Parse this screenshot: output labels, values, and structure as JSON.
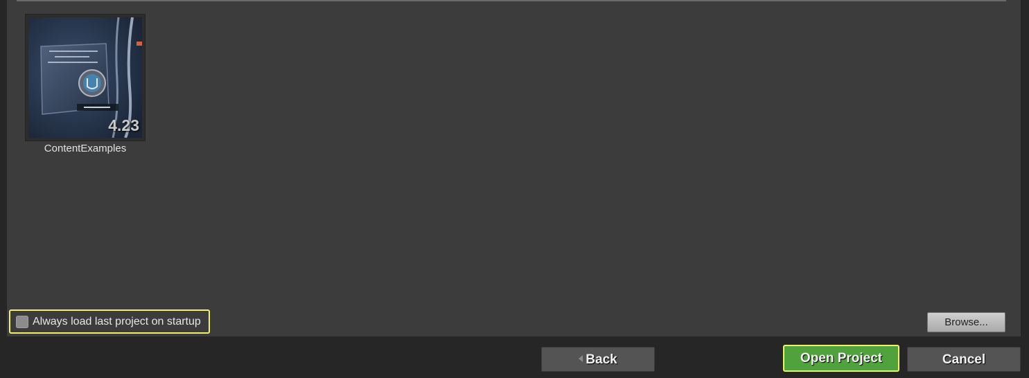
{
  "projects": [
    {
      "name": "ContentExamples",
      "version": "4.23",
      "thumbnail_icon": "unreal-engine-welcome-screen-thumbnail"
    }
  ],
  "startup_option": {
    "label": "Always load last project on startup",
    "checked": false
  },
  "buttons": {
    "browse": "Browse...",
    "back": "Back",
    "open_project": "Open Project",
    "cancel": "Cancel"
  },
  "colors": {
    "panel_background": "#3c3c3c",
    "window_background": "#262626",
    "primary_button": "#4fa23c",
    "highlight_outline": "#f4f06a"
  }
}
